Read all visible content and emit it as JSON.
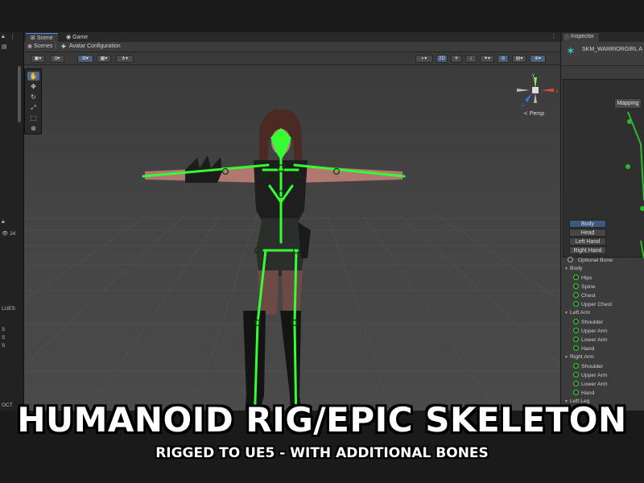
{
  "left_panel": {
    "items": [
      "24",
      "LUES",
      "S",
      "S",
      "S",
      "OCT"
    ]
  },
  "scene": {
    "tabs": [
      {
        "label": "Scene",
        "icon": "grid-icon",
        "active": true
      },
      {
        "label": "Game",
        "icon": "gamepad-icon",
        "active": false
      }
    ],
    "breadcrumb": {
      "root": "Scenes",
      "current": "Avatar Configuration"
    },
    "toolbar": {
      "view_mode_2d": "2D"
    },
    "view_label": "Persp"
  },
  "tools": [
    "hand-tool-icon",
    "move-tool-icon",
    "rotate-tool-icon",
    "scale-tool-icon",
    "rect-tool-icon",
    "transform-tool-icon"
  ],
  "inspector": {
    "tab_label": "Inspector",
    "object_name": "SKM_WARRIORGIRL A",
    "mapping_tab": "Mapping",
    "body_parts": [
      "Body",
      "Head",
      "Left Hand",
      "Right Hand"
    ],
    "optional_bone_label": "Optional Bone",
    "groups": [
      {
        "name": "Body",
        "bones": [
          "Hips",
          "Spine",
          "Chest",
          "Upper Chest"
        ]
      },
      {
        "name": "Left Arm",
        "bones": [
          "Shoulder",
          "Upper Arm",
          "Lower Arm",
          "Hand"
        ]
      },
      {
        "name": "Right Arm",
        "bones": [
          "Shoulder",
          "Upper Arm",
          "Lower Arm",
          "Hand"
        ]
      }
    ],
    "trailing_group": "Left Leg"
  },
  "banner": {
    "title": "HUMANOID RIG/EPIC SKELETON",
    "subtitle": "RIGGED TO UE5 - WITH ADDITIONAL BONES"
  },
  "colors": {
    "bone_green": "#33ff33",
    "selection_blue": "#3b5a7e",
    "panel_bg": "#3c3c3c"
  }
}
